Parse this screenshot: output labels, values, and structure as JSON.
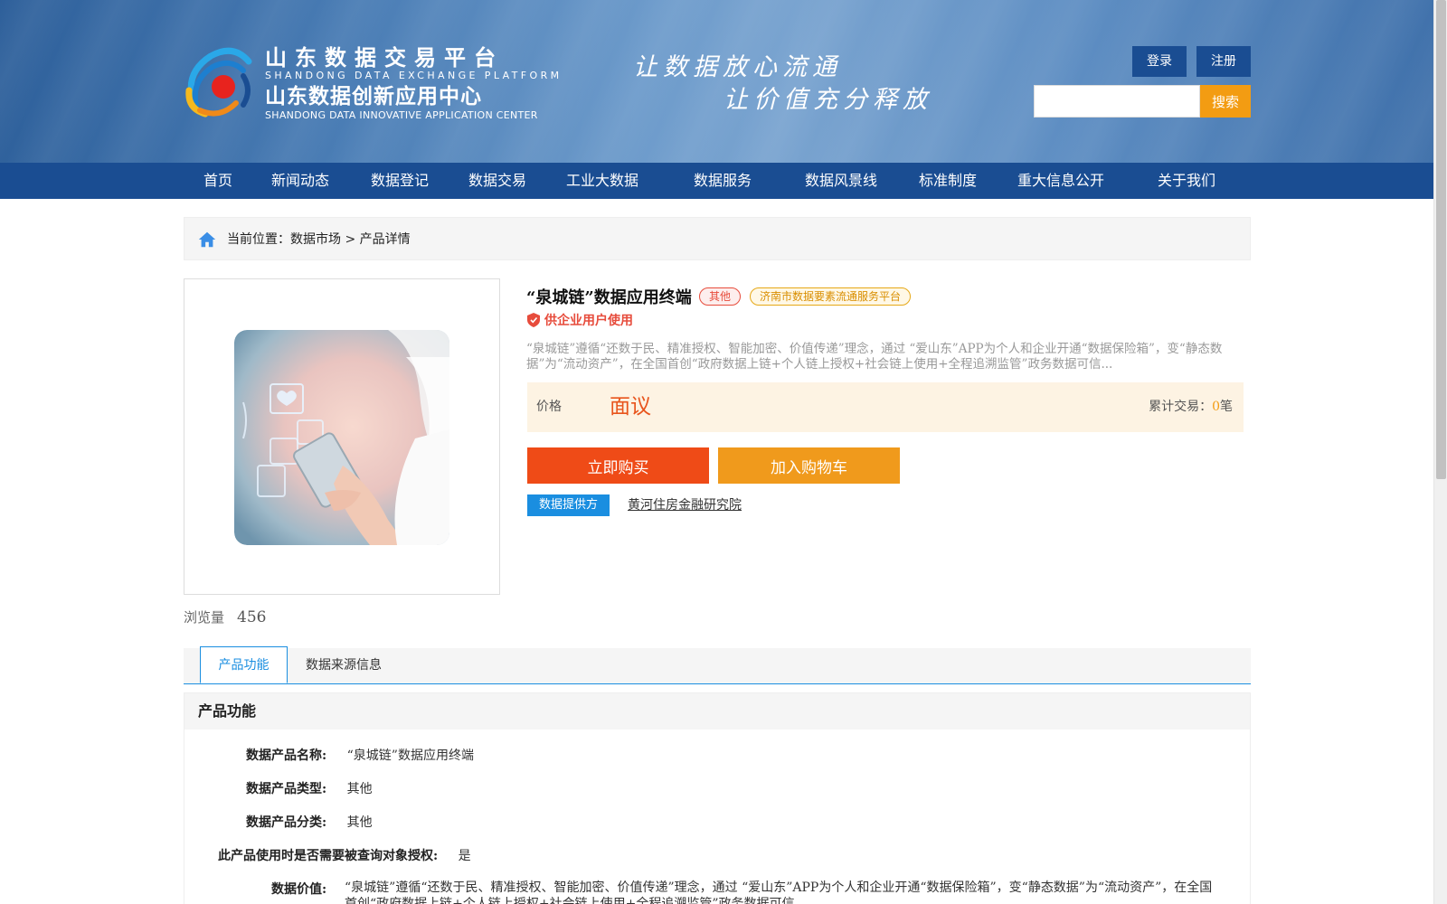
{
  "header": {
    "logo_cn1": "山东数据交易平台",
    "logo_en1": "SHANDONG DATA EXCHANGE PLATFORM",
    "logo_cn2": "山东数据创新应用中心",
    "logo_en2": "SHANDONG DATA INNOVATIVE APPLICATION CENTER",
    "slogan1": "让数据放心流通",
    "slogan2": "让价值充分释放",
    "login_label": "登录",
    "register_label": "注册",
    "search_placeholder": "",
    "search_label": "搜索"
  },
  "nav": {
    "items": [
      {
        "label": "首页"
      },
      {
        "label": "新闻动态"
      },
      {
        "label": "数据登记"
      },
      {
        "label": "数据交易"
      },
      {
        "label": "工业大数据"
      },
      {
        "label": "数据服务"
      },
      {
        "label": "数据风景线"
      },
      {
        "label": "标准制度"
      },
      {
        "label": "重大信息公开"
      },
      {
        "label": "关于我们"
      }
    ]
  },
  "breadcrumb": {
    "prefix": "当前位置：",
    "level1": "数据市场",
    "sep": " > ",
    "level2": "产品详情"
  },
  "product": {
    "title": "“泉城链”数据应用终端",
    "tag_category": "其他",
    "tag_platform": "济南市数据要素流通服务平台",
    "usage": "供企业用户使用",
    "description": "“泉城链”遵循“还数于民、精准授权、智能加密、价值传递”理念，通过 “爱山东”APP为个人和企业开通“数据保险箱”，变“静态数据”为“流动资产”，在全国首创“政府数据上链+个人链上授权+社会链上使用+全程追溯监管”政务数据可信...",
    "price_label": "价格",
    "price_value": "面议",
    "trade_label": "累计交易：",
    "trade_count": "0",
    "trade_unit": "笔",
    "buy_label": "立即购买",
    "cart_label": "加入购物车",
    "provider_badge": "数据提供方",
    "provider_name": "黄河住房金融研究院",
    "views_label": "浏览量",
    "views_count": "456"
  },
  "tabs": {
    "items": [
      {
        "label": "产品功能",
        "active": true
      },
      {
        "label": "数据来源信息",
        "active": false
      }
    ]
  },
  "section": {
    "title": "产品功能",
    "rows": [
      {
        "label": "数据产品名称:",
        "value": "“泉城链”数据应用终端"
      },
      {
        "label": "数据产品类型:",
        "value": "其他"
      },
      {
        "label": "数据产品分类:",
        "value": "其他"
      },
      {
        "label": "此产品使用时是否需要被查询对象授权:",
        "value": "是"
      },
      {
        "label": "数据价值:",
        "value": "“泉城链”遵循“还数于民、精准授权、智能加密、价值传递”理念，通过 “爱山东”APP为个人和企业开通“数据保险箱”，变“静态数据”为“流动资产”，在全国首创“政府数据上链+个人链上授权+社会链上使用+全程追溯监管”政务数据可信..."
      }
    ]
  },
  "colors": {
    "nav_bg": "#1a4d92",
    "accent_blue": "#1a8ee0",
    "buy_red": "#ef4b17",
    "cart_orange": "#f09a1c",
    "price_bg": "#fdf3e3"
  }
}
